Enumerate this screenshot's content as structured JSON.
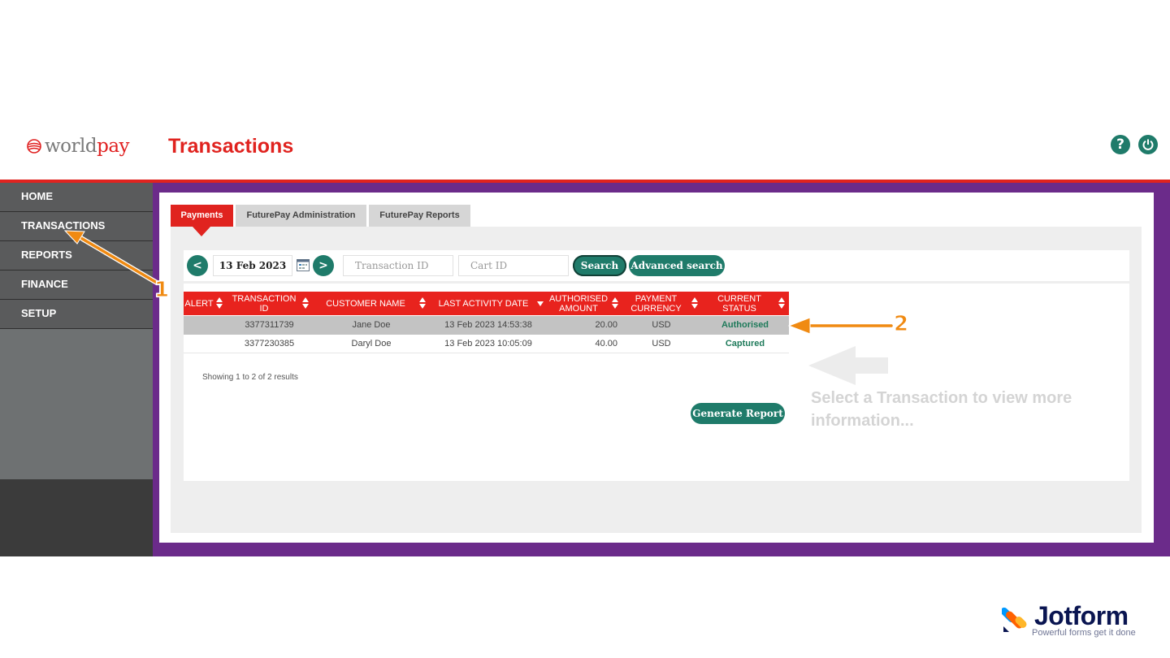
{
  "brand": {
    "part1": "world",
    "part2": "pay"
  },
  "header": {
    "title": "Transactions",
    "help_glyph": "?",
    "help_icon": "help-icon",
    "power_icon": "power-icon"
  },
  "sidebar": {
    "items": [
      {
        "label": "HOME"
      },
      {
        "label": "TRANSACTIONS"
      },
      {
        "label": "REPORTS"
      },
      {
        "label": "FINANCE"
      },
      {
        "label": "SETUP"
      }
    ]
  },
  "tabs": [
    {
      "label": "Payments",
      "active": true
    },
    {
      "label": "FuturePay Administration",
      "active": false
    },
    {
      "label": "FuturePay Reports",
      "active": false
    }
  ],
  "search": {
    "prev_label": "<",
    "next_label": ">",
    "date": "13 Feb 2023",
    "transaction_id_placeholder": "Transaction ID",
    "cart_id_placeholder": "Cart ID",
    "search_label": "Search",
    "advanced_label": "Advanced search"
  },
  "table": {
    "columns": [
      {
        "label": "ALERT"
      },
      {
        "label": "TRANSACTION ID"
      },
      {
        "label": "CUSTOMER NAME"
      },
      {
        "label": "LAST ACTIVITY DATE"
      },
      {
        "label": "AUTHORISED AMOUNT"
      },
      {
        "label": "PAYMENT CURRENCY"
      },
      {
        "label": "CURRENT STATUS"
      }
    ],
    "rows": [
      {
        "alert": "",
        "transaction_id": "3377311739",
        "customer": "Jane Doe",
        "date": "13 Feb 2023 14:53:38",
        "amount": "20.00",
        "currency": "USD",
        "status": "Authorised",
        "selected": true
      },
      {
        "alert": "",
        "transaction_id": "3377230385",
        "customer": "Daryl Doe",
        "date": "13 Feb 2023 10:05:09",
        "amount": "40.00",
        "currency": "USD",
        "status": "Captured",
        "selected": false
      }
    ],
    "showing": "Showing 1 to 2 of 2 results"
  },
  "generate_report_label": "Generate Report",
  "info_placeholder": "Select a Transaction to view more information...",
  "annotations": {
    "one": "1",
    "two": "2"
  },
  "colors": {
    "brand_red": "#e0231f",
    "frame_purple": "#6b2b8a",
    "action_green": "#1f7b6a",
    "annotation_orange": "#f08a12"
  },
  "watermark": {
    "name": "Jotform",
    "tagline": "Powerful forms get it done"
  }
}
